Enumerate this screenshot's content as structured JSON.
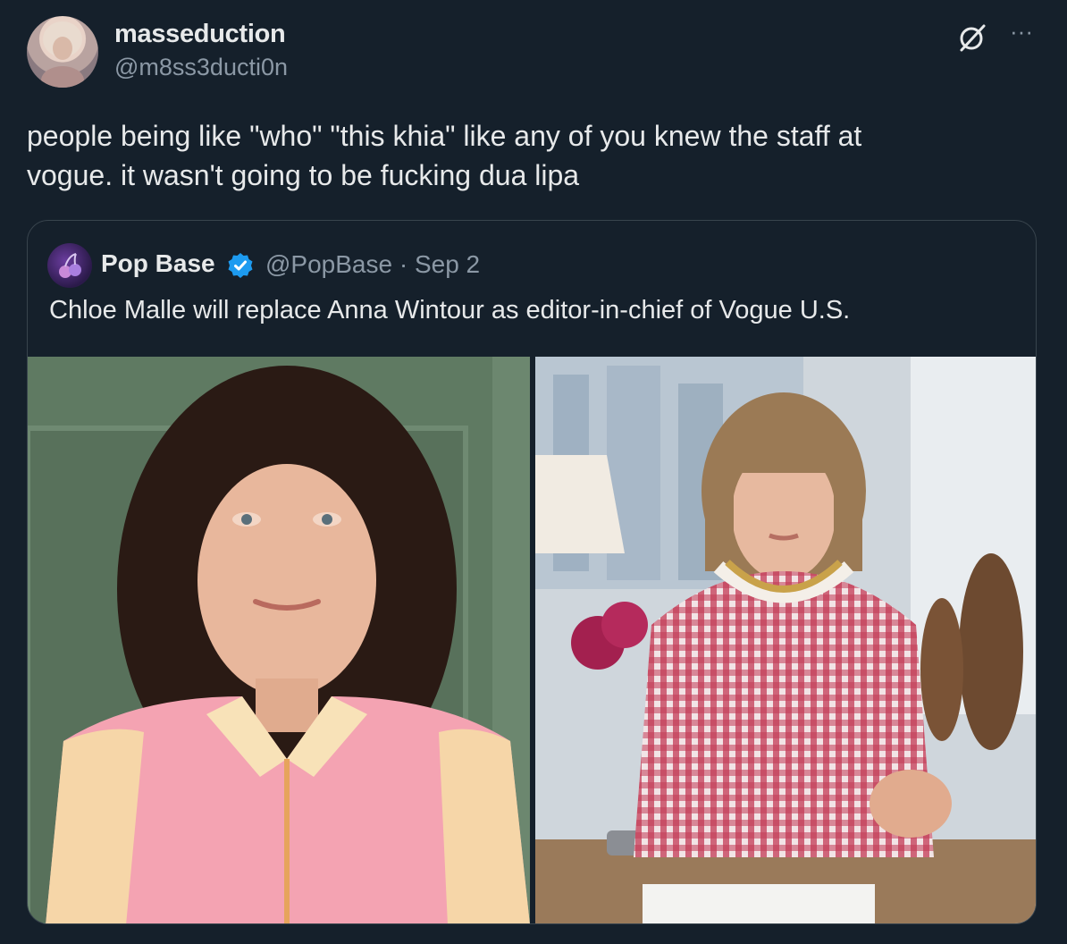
{
  "tweet": {
    "author": {
      "display_name": "masseduction",
      "handle": "@m8ss3ducti0n",
      "avatar_icon": "avatar-image"
    },
    "text_line1": "people being like \"who\" \"this khia\" like any of you knew the staff at",
    "text_line2": "vogue. it wasn't going to be fucking dua lipa",
    "actions": {
      "grok_icon": "grok-icon",
      "more_label": "···"
    }
  },
  "quote": {
    "author": {
      "display_name": "Pop Base",
      "verified": true,
      "handle_date": "@PopBase · Sep 2"
    },
    "text": "Chloe Malle will replace Anna Wintour as editor-in-chief of Vogue U.S.",
    "photos": [
      {
        "subject": "woman with curly dark hair in pink and cream shirt",
        "background": "#5f7a62"
      },
      {
        "subject": "woman with bob haircut in red gingham top at desk",
        "background": "#cfd6dc"
      }
    ]
  },
  "colors": {
    "background": "#15202b",
    "text_primary": "#e7e9ea",
    "text_secondary": "#8b98a5",
    "border": "#38444d",
    "verified_blue": "#1d9bf0"
  }
}
